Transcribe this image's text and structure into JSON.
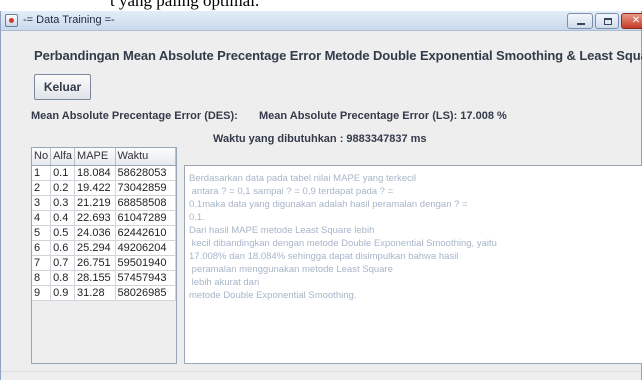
{
  "caption_fragment": "t yang paling optimal.",
  "window": {
    "title": "-= Data Training =-",
    "minimize_glyph": "",
    "maximize_glyph": "",
    "close_glyph": "✕"
  },
  "heading": "Perbandingan Mean Absolute Precentage Error Metode Double Exponential Smoothing & Least Square",
  "keluar_label": "Keluar",
  "mape_des_label": "Mean Absolute Precentage Error (DES):",
  "mape_ls_label": "Mean Absolute Precentage Error (LS):  17.008 %",
  "waktu_label": "Waktu yang dibutuhkan : 9883347837 ms",
  "table": {
    "headers": [
      "No",
      "Alfa",
      "MAPE",
      "Waktu"
    ],
    "rows": [
      [
        "1",
        "0.1",
        "18.084",
        "58628053"
      ],
      [
        "2",
        "0.2",
        "19.422",
        "73042859"
      ],
      [
        "3",
        "0.3",
        "21.219",
        "68858508"
      ],
      [
        "4",
        "0.4",
        "22.693",
        "61047289"
      ],
      [
        "5",
        "0.5",
        "24.036",
        "62442610"
      ],
      [
        "6",
        "0.6",
        "25.294",
        "49206204"
      ],
      [
        "7",
        "0.7",
        "26.751",
        "59501940"
      ],
      [
        "8",
        "0.8",
        "28.155",
        "57457943"
      ],
      [
        "9",
        "0.9",
        "31.28",
        "58026985"
      ]
    ]
  },
  "result_text": [
    "Berdasarkan data pada tabel nilai MAPE yang terkecil",
    " antara ? = 0,1 sampai ? = 0,9 terdapat pada ? =",
    "0.1maka data yang digunakan adalah hasil peramalan dengan ? =",
    "0.1.",
    "",
    "Dari hasil MAPE metode Least Square lebih",
    " kecil dibandingkan dengan metode Double Exponential Smoothing, yaitu",
    "17.008% dan 18.084% sehingga dapat disimpulkan bahwa hasil",
    " peramalan menggunakan metode Least Square",
    " lebih akurat dari",
    "metode Double Exponential Smoothing."
  ],
  "colors": {
    "heading": "#333b4a",
    "textarea_text": "#a7b5c9",
    "window_bg": "#eeeeee"
  }
}
